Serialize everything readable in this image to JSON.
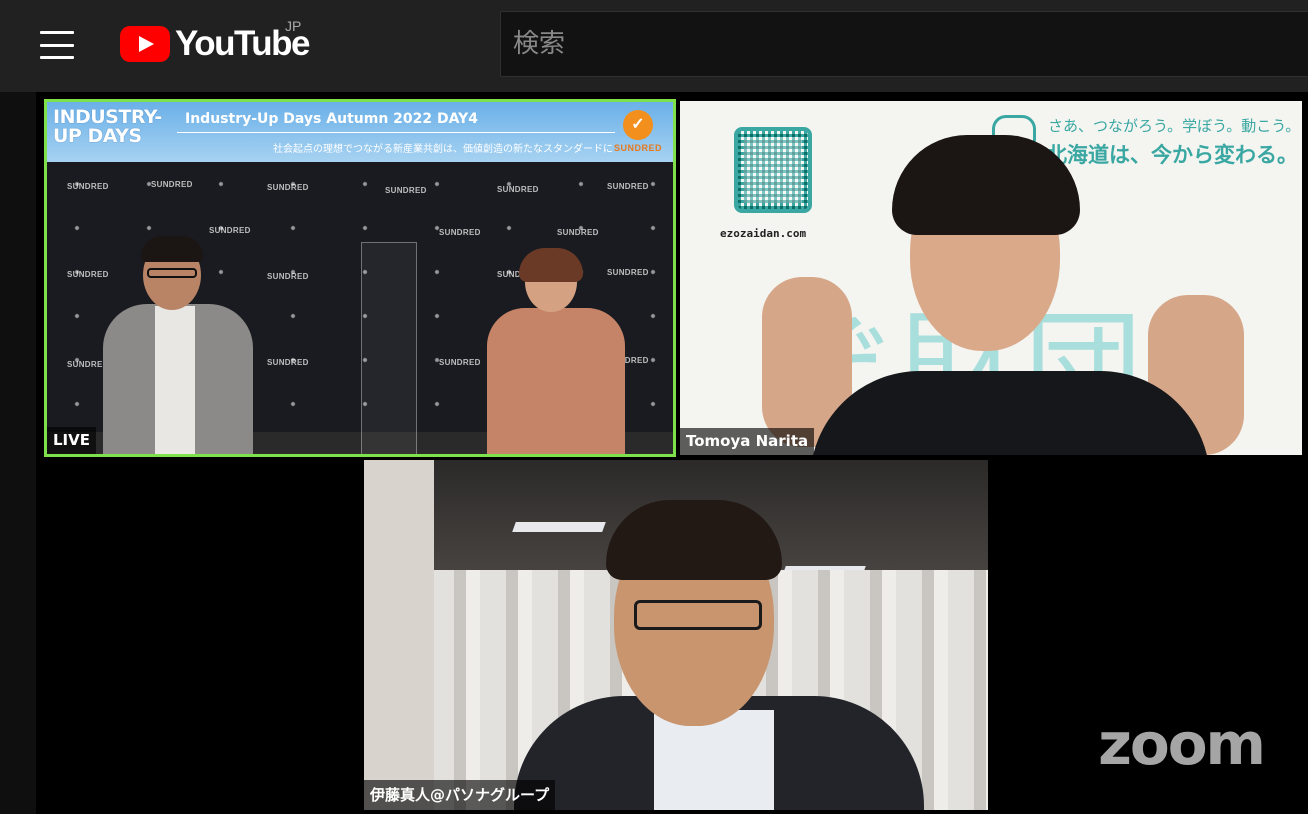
{
  "masthead": {
    "logo_text": "YouTube",
    "region": "JP",
    "search_placeholder": "検索"
  },
  "stream": {
    "studio_tile": {
      "banner_logo": "INDUSTRY-UP DAYS",
      "banner_title": "Industry-Up Days Autumn 2022 DAY4",
      "banner_subtitle": "社会起点の理想でつながる新産業共創は、価値創造の新たなスタンダードに",
      "sponsor": "SUNDRED",
      "name_tag": "LIVE"
    },
    "participant_tile": {
      "name_tag": "Tomoya Narita",
      "url": "ezozaidan.com",
      "slogan_line1": "さあ、つながろう。学ぼう。動こう。",
      "slogan_line2": "北海道は、今から変わる。",
      "background_text": "ぞ財団"
    },
    "speaker_tile": {
      "name_tag": "伊藤真人@パソナグループ"
    },
    "watermark": "zoom"
  },
  "colors": {
    "active_speaker_border": "#7ee04a",
    "youtube_red": "#ff0000",
    "ezo_teal": "#3aa7a2"
  }
}
